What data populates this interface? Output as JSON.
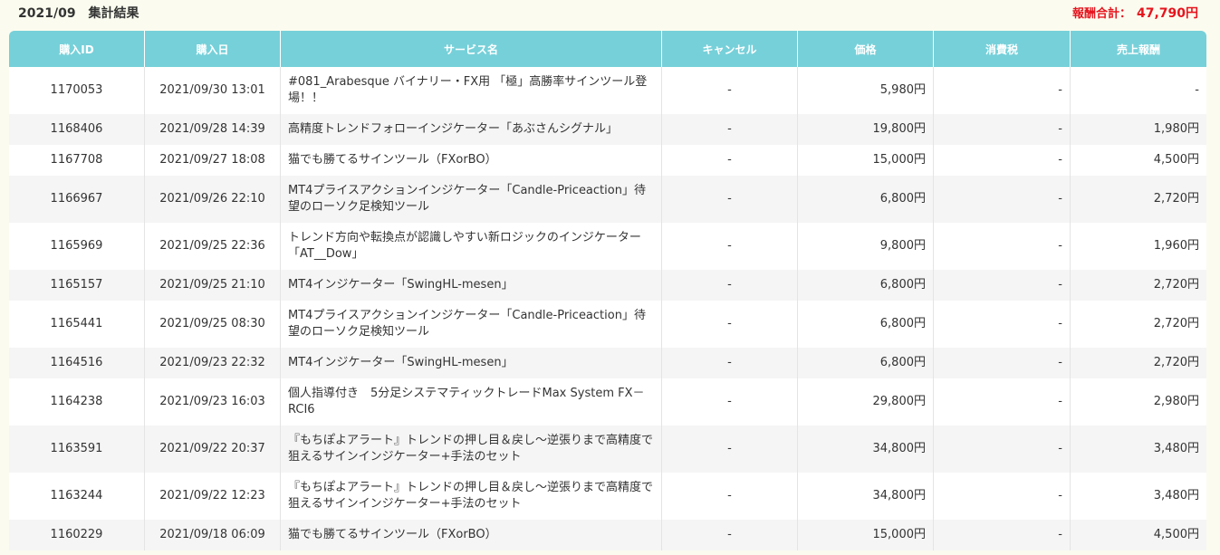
{
  "header": {
    "title": "2021/09　集計結果",
    "total_label": "報酬合計：",
    "total_value": "47,790円"
  },
  "colors": {
    "header_bg": "#76d0d9",
    "total_text": "#e6141e",
    "page_bg": "#fbfcef"
  },
  "table": {
    "columns": [
      "購入ID",
      "購入日",
      "サービス名",
      "キャンセル",
      "価格",
      "消費税",
      "売上報酬"
    ],
    "rows": [
      {
        "id": "1170053",
        "date": "2021/09/30 13:01",
        "service": "#081_Arabesque バイナリー・FX用 「極」高勝率サインツール登場！！",
        "cancel": "-",
        "price": "5,980円",
        "tax": "-",
        "reward": "-"
      },
      {
        "id": "1168406",
        "date": "2021/09/28 14:39",
        "service": "高精度トレンドフォローインジケーター「あぶさんシグナル」",
        "cancel": "-",
        "price": "19,800円",
        "tax": "-",
        "reward": "1,980円"
      },
      {
        "id": "1167708",
        "date": "2021/09/27 18:08",
        "service": "猫でも勝てるサインツール（FXorBO）",
        "cancel": "-",
        "price": "15,000円",
        "tax": "-",
        "reward": "4,500円"
      },
      {
        "id": "1166967",
        "date": "2021/09/26 22:10",
        "service": "MT4プライスアクションインジケーター「Candle-Priceaction」待望のローソク足検知ツール",
        "cancel": "-",
        "price": "6,800円",
        "tax": "-",
        "reward": "2,720円"
      },
      {
        "id": "1165969",
        "date": "2021/09/25 22:36",
        "service": "トレンド方向や転換点が認識しやすい新ロジックのインジケーター「AT__Dow」",
        "cancel": "-",
        "price": "9,800円",
        "tax": "-",
        "reward": "1,960円"
      },
      {
        "id": "1165157",
        "date": "2021/09/25 21:10",
        "service": "MT4インジケーター「SwingHL-mesen」",
        "cancel": "-",
        "price": "6,800円",
        "tax": "-",
        "reward": "2,720円"
      },
      {
        "id": "1165441",
        "date": "2021/09/25 08:30",
        "service": "MT4プライスアクションインジケーター「Candle-Priceaction」待望のローソク足検知ツール",
        "cancel": "-",
        "price": "6,800円",
        "tax": "-",
        "reward": "2,720円"
      },
      {
        "id": "1164516",
        "date": "2021/09/23 22:32",
        "service": "MT4インジケーター「SwingHL-mesen」",
        "cancel": "-",
        "price": "6,800円",
        "tax": "-",
        "reward": "2,720円"
      },
      {
        "id": "1164238",
        "date": "2021/09/23 16:03",
        "service": "個人指導付き　5分足システマティックトレードMax System FX－RCI6",
        "cancel": "-",
        "price": "29,800円",
        "tax": "-",
        "reward": "2,980円"
      },
      {
        "id": "1163591",
        "date": "2021/09/22 20:37",
        "service": "『もちぽよアラート』トレンドの押し目＆戻し～逆張りまで高精度で狙えるサインインジケーター+手法のセット",
        "cancel": "-",
        "price": "34,800円",
        "tax": "-",
        "reward": "3,480円"
      },
      {
        "id": "1163244",
        "date": "2021/09/22 12:23",
        "service": "『もちぽよアラート』トレンドの押し目＆戻し～逆張りまで高精度で狙えるサインインジケーター+手法のセット",
        "cancel": "-",
        "price": "34,800円",
        "tax": "-",
        "reward": "3,480円"
      },
      {
        "id": "1160229",
        "date": "2021/09/18 06:09",
        "service": "猫でも勝てるサインツール（FXorBO）",
        "cancel": "-",
        "price": "15,000円",
        "tax": "-",
        "reward": "4,500円"
      }
    ]
  }
}
